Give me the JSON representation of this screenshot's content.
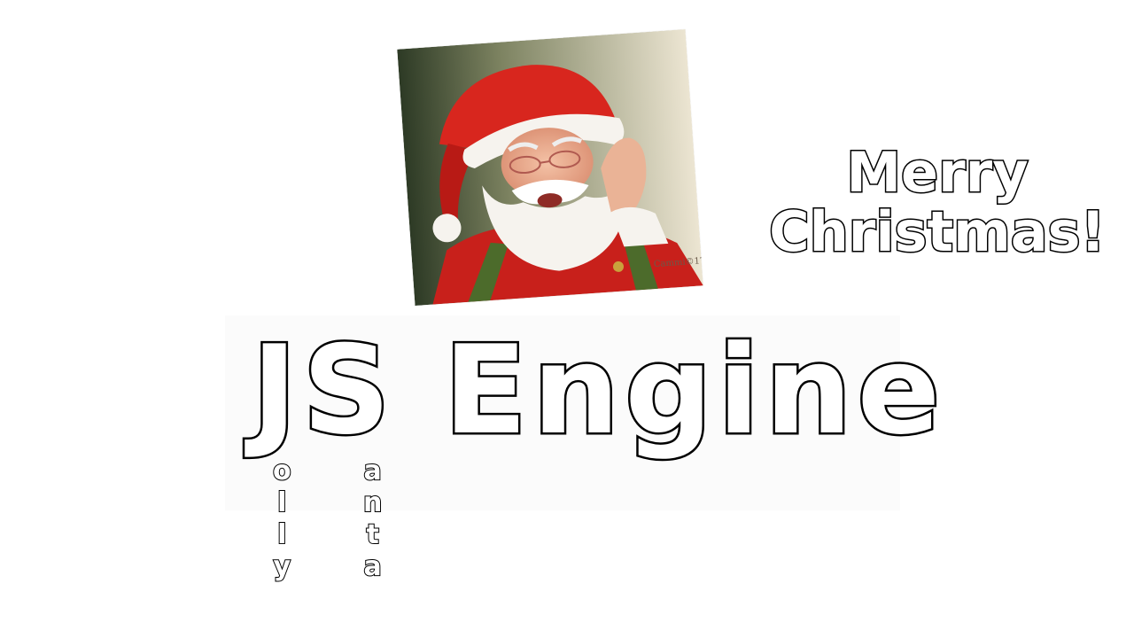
{
  "slide": {
    "image_alt": "Santa Claus painting",
    "image_signature": "Cammi©17",
    "greeting": {
      "line1": "Merry",
      "line2": "Christmas!"
    },
    "title": "JS Engine",
    "acrostic": {
      "j_letters": [
        "o",
        "l",
        "l",
        "y"
      ],
      "s_letters": [
        "a",
        "n",
        "t",
        "a"
      ]
    },
    "colors": {
      "santa_red": "#d8261e",
      "beard_white": "#f6f3ee",
      "background_cream": "#ece5d2",
      "text_fill": "#ffffff",
      "text_outline": "#000000"
    }
  }
}
